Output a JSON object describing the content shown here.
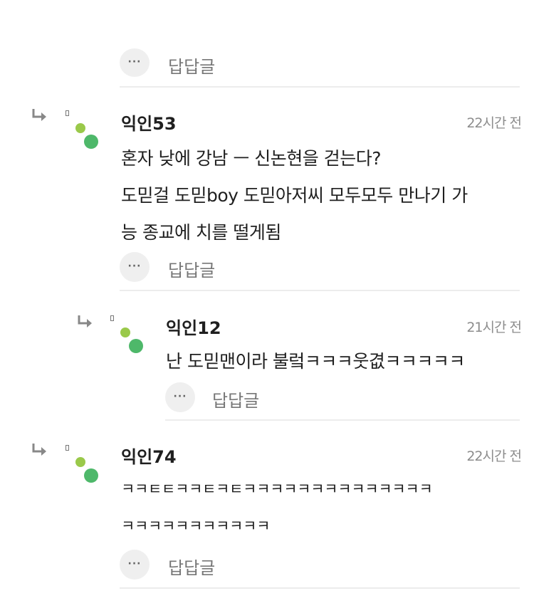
{
  "top_partial": {
    "reply_label": "답답글",
    "more_glyph": "···"
  },
  "comments": [
    {
      "author": "익인53",
      "time": "22시간 전",
      "lines": [
        "혼자 낮에 강남 ㅡ 신논현을 걷는다?",
        "도믿걸 도믿boy 도믿아저씨 모두모두 만나기 가",
        "능 종교에 치를 떨게됨"
      ],
      "reply_label": "답답글",
      "more_glyph": "···"
    },
    {
      "author": "익인12",
      "time": "21시간 전",
      "lines": [
        "난 도믿맨이라 불렄ㅋㅋㅋ웃겺ㅋㅋㅋㅋㅋ"
      ],
      "reply_label": "답답글",
      "more_glyph": "···"
    },
    {
      "author": "익인74",
      "time": "22시간 전",
      "lines": [
        "ㅋㅋㅌㅌㅋㅋㅌㅋㅌㅋㅋㅋㅋㅋㅋㅋㅋㅋㅋㅋㅋㅋㅋ",
        "ㅋㅋㅋㅋㅋㅋㅋㅋㅋㅋㅋ"
      ],
      "reply_label": "답답글",
      "more_glyph": "···"
    }
  ],
  "colors": {
    "dot_small": "#9ac94a",
    "dot_large": "#4eb86a",
    "divider": "#ececec",
    "meta_text": "#8c8c8c"
  }
}
